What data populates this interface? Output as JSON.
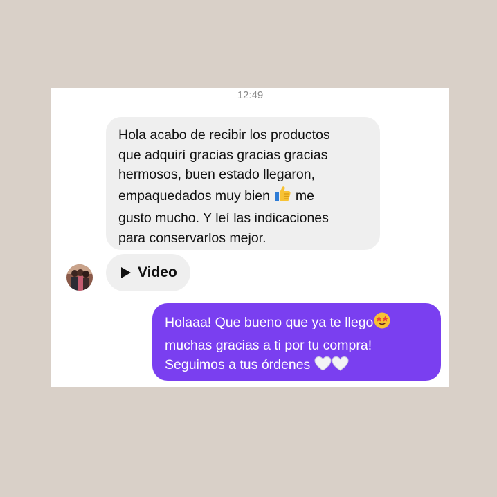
{
  "chat": {
    "timestamp": "12:49",
    "incoming_message": {
      "lines": [
        "Hola acabo de recibir los productos",
        "que adquirí gracias gracias  gracias",
        "hermosos, buen estado llegaron,",
        "empaquedados muy bien",
        "me",
        "gusto mucho. Y leí las indicaciones",
        "para conservarlos mejor."
      ],
      "emoji": "thumbs-up-icon"
    },
    "video_message": {
      "label": "Video",
      "icon": "play-icon"
    },
    "outgoing_message": {
      "lines": [
        "Holaaa! Que bueno que ya te llego",
        "muchas gracias a ti por tu compra!",
        "Seguimos a tus órdenes"
      ],
      "emojis": [
        "star-struck-icon",
        "white-heart-icon",
        "white-heart-icon"
      ]
    }
  },
  "colors": {
    "page_background": "#d9d0c8",
    "incoming_bubble": "#efefef",
    "outgoing_bubble": "#7a3ff0",
    "timestamp_text": "#8a8a8a"
  }
}
